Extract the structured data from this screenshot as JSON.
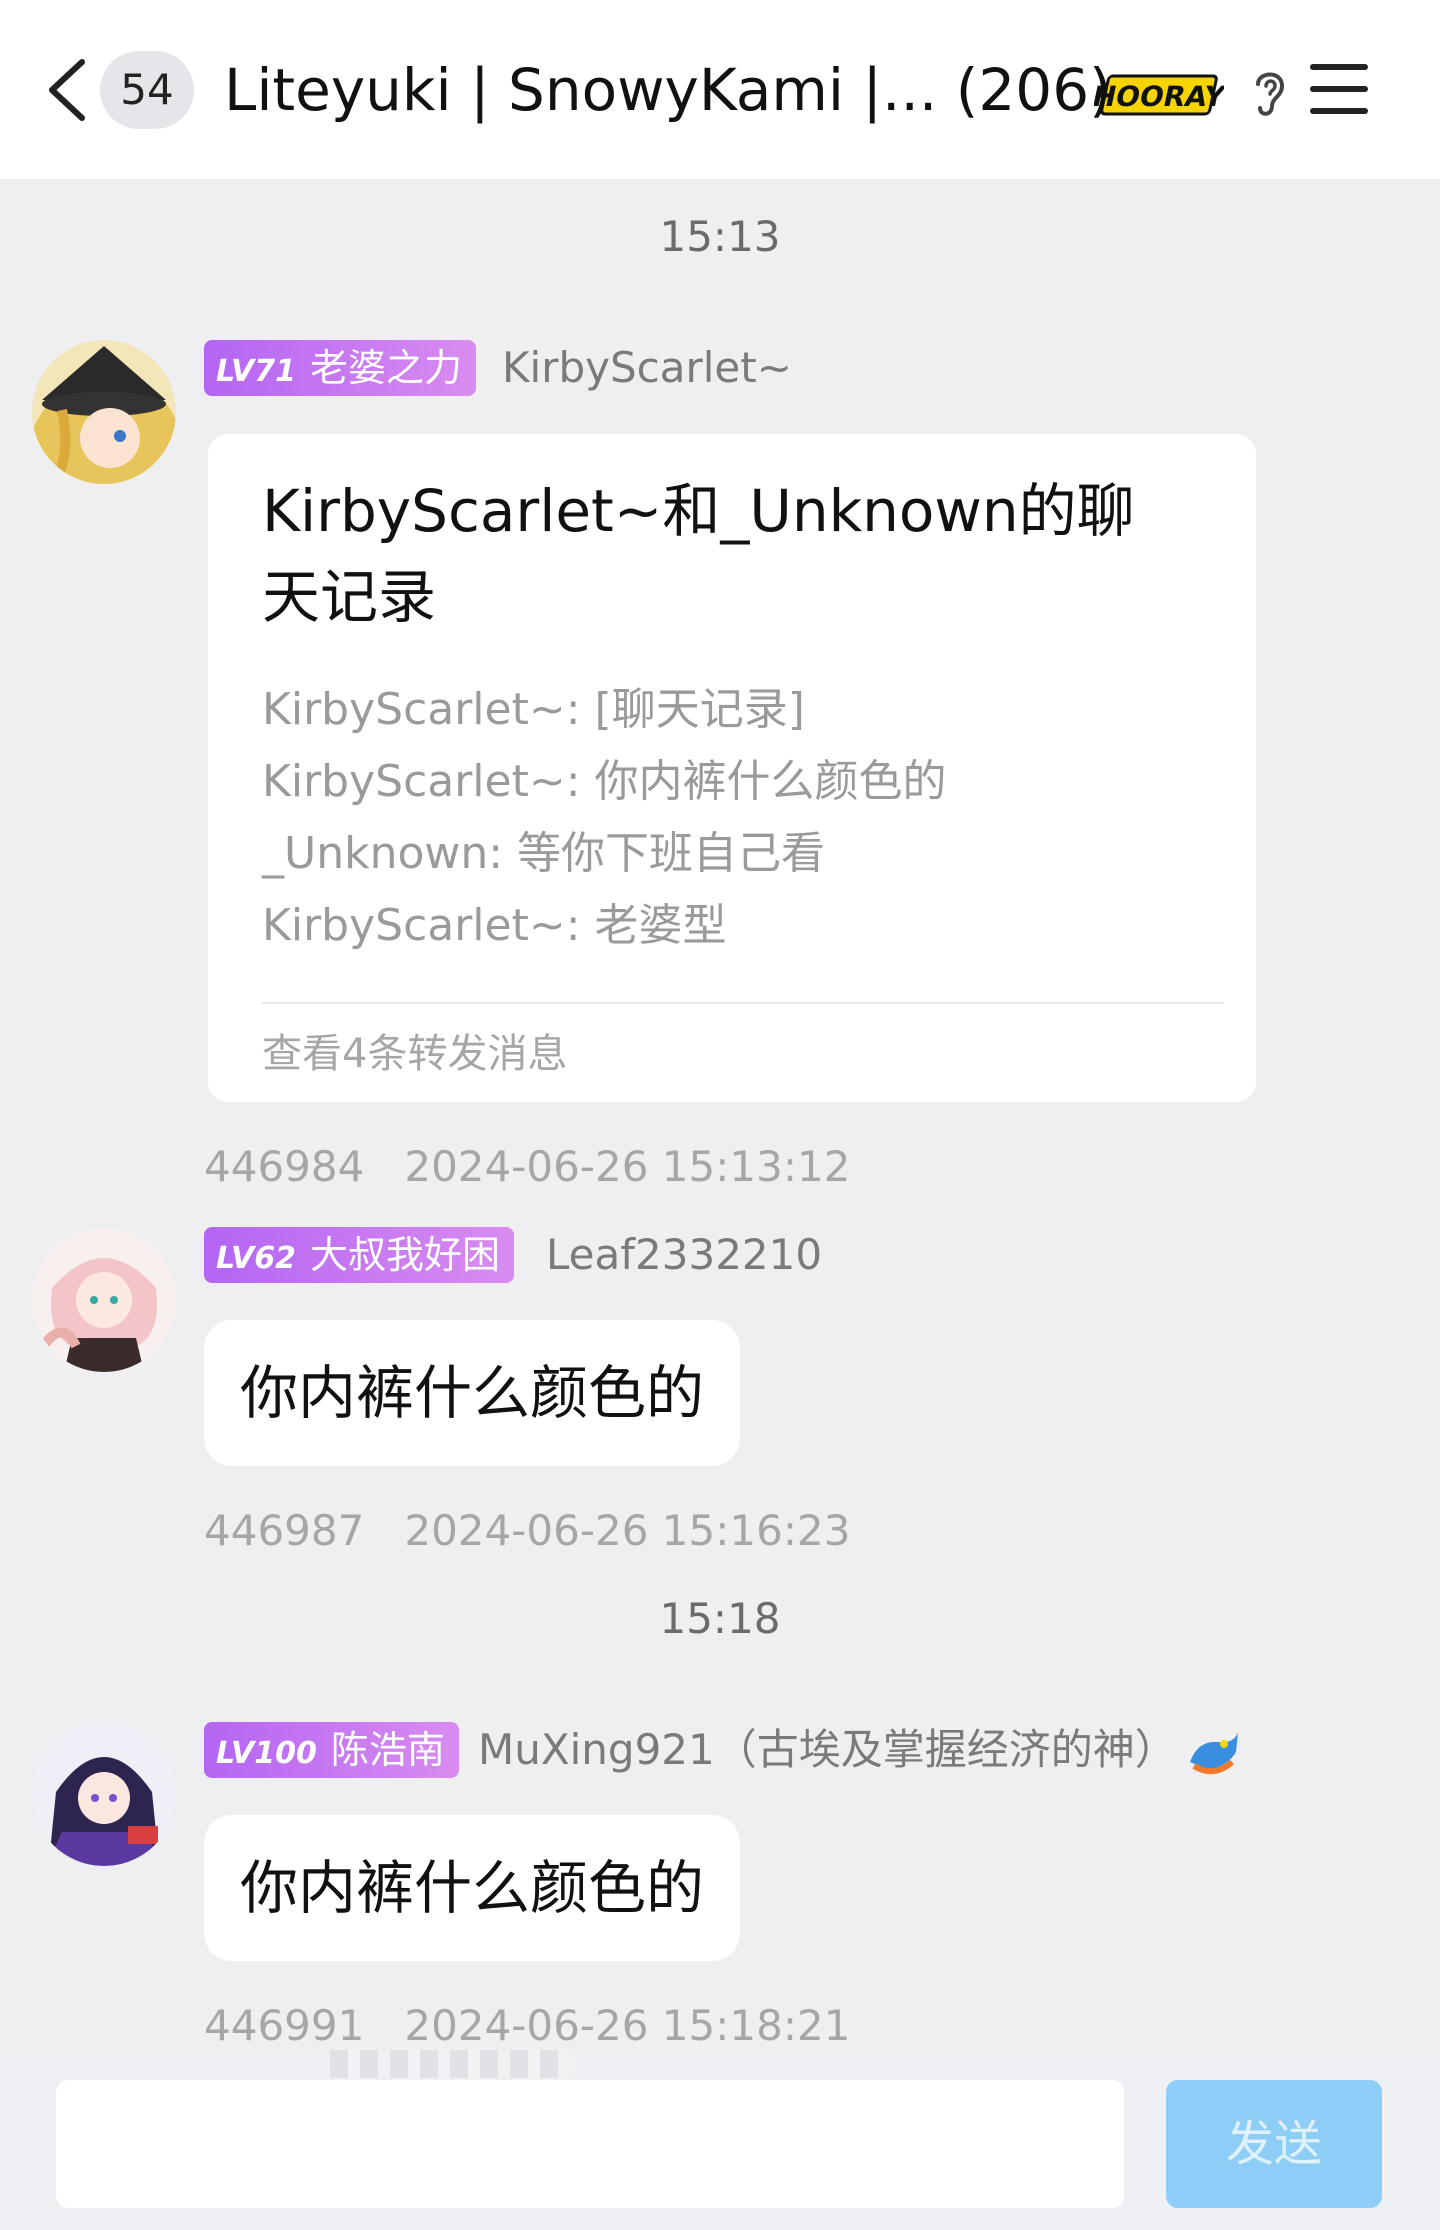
{
  "header": {
    "unread_count": "54",
    "title": "Liteyuki | SnowyKami |... (206)",
    "badge_text": "HOORAY"
  },
  "messages": [
    {
      "time_divider": "15:13",
      "level": "LV71",
      "title": "老婆之力",
      "sender": "KirbyScarlet~",
      "forward": {
        "title": "KirbyScarlet~和_Unknown的聊天记录",
        "lines": [
          "KirbyScarlet~: [聊天记录]",
          "KirbyScarlet~: 你内裤什么颜色的",
          "_Unknown: 等你下班自己看",
          "KirbyScarlet~: 老婆型"
        ],
        "footer": "查看4条转发消息"
      },
      "id": "446984",
      "timestamp": "2024-06-26 15:13:12"
    },
    {
      "level": "LV62",
      "title": "大叔我好困",
      "sender": "Leaf2332210",
      "text": "你内裤什么颜色的",
      "id": "446987",
      "timestamp": "2024-06-26 15:16:23"
    },
    {
      "time_divider": "15:18",
      "level": "LV100",
      "title": "陈浩南",
      "sender": "MuXing921（古埃及掌握经济的神）",
      "text": "你内裤什么颜色的",
      "id": "446991",
      "timestamp": "2024-06-26 15:18:21"
    }
  ],
  "input": {
    "value": "",
    "placeholder": "",
    "send_label": "发送"
  },
  "colors": {
    "level_badge": "#c177f2",
    "send_button": "#8ecdf5",
    "background": "#efeff1"
  }
}
